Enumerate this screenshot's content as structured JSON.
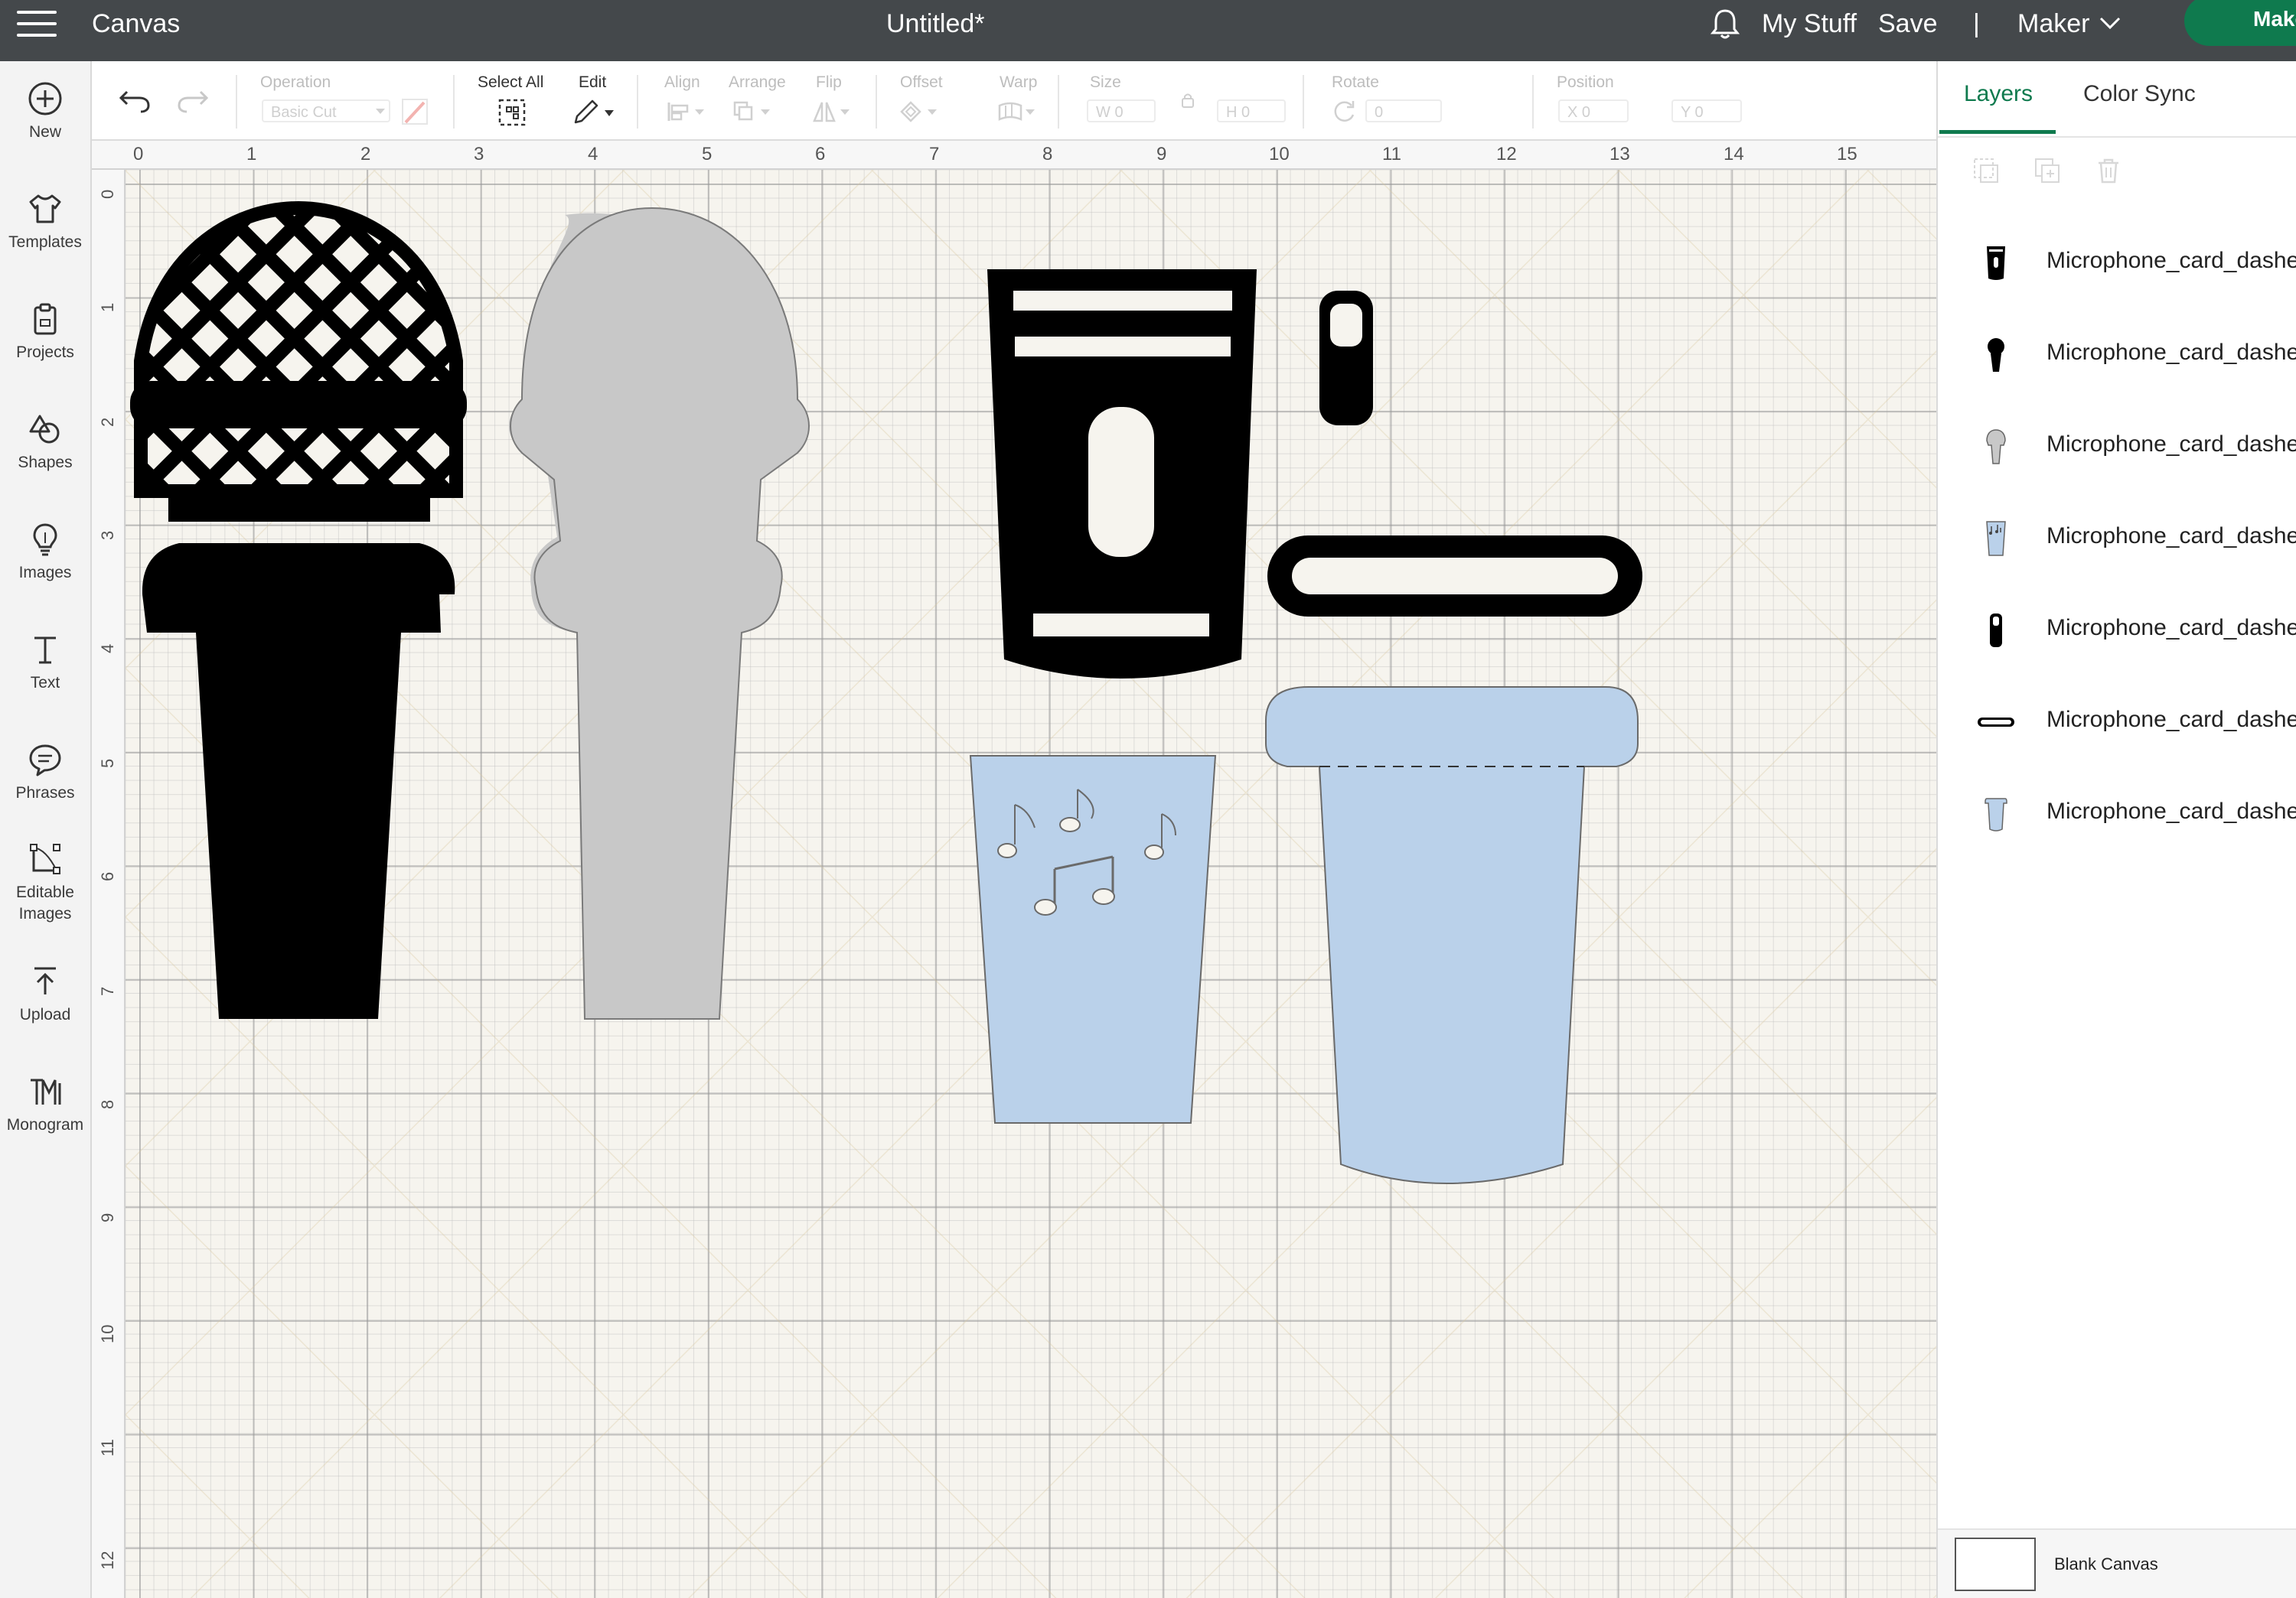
{
  "header": {
    "app_name": "Canvas",
    "doc_title": "Untitled*",
    "my_stuff": "My Stuff",
    "save": "Save",
    "separator": "|",
    "machine": "Maker",
    "make": "Make",
    "icons": [
      "menu-icon",
      "bell-icon",
      "chevron-down-icon"
    ]
  },
  "sidebar": {
    "items": [
      {
        "label": "New",
        "icon": "plus-circle-icon"
      },
      {
        "label": "Templates",
        "icon": "shirt-icon"
      },
      {
        "label": "Projects",
        "icon": "clipboard-icon"
      },
      {
        "label": "Shapes",
        "icon": "shapes-icon"
      },
      {
        "label": "Images",
        "icon": "lightbulb-icon"
      },
      {
        "label": "Text",
        "icon": "text-icon"
      },
      {
        "label": "Phrases",
        "icon": "speech-bubble-icon"
      },
      {
        "label": "Editable",
        "label2": "Images",
        "icon": "vector-edit-icon"
      },
      {
        "label": "Upload",
        "icon": "upload-icon"
      },
      {
        "label": "Monogram",
        "icon": "monogram-icon"
      }
    ]
  },
  "toolbar": {
    "operation_label": "Operation",
    "operation_value": "Basic Cut",
    "select_all": "Select All",
    "edit": "Edit",
    "align": "Align",
    "arrange": "Arrange",
    "flip": "Flip",
    "offset": "Offset",
    "warp": "Warp",
    "size": "Size",
    "size_w": "W",
    "size_h": "H",
    "rotate": "Rotate",
    "position": "Position",
    "pos_x": "X",
    "pos_y": "Y",
    "field_value": "0"
  },
  "rulers": {
    "top": [
      "0",
      "1",
      "2",
      "3",
      "4",
      "5",
      "6",
      "7",
      "8",
      "9",
      "10",
      "11",
      "12",
      "13",
      "14",
      "15"
    ],
    "left": [
      "0",
      "1",
      "2",
      "3",
      "4",
      "5",
      "6",
      "7",
      "8",
      "9",
      "10",
      "11",
      "12"
    ]
  },
  "panel": {
    "tabs": [
      "Layers",
      "Color Sync"
    ],
    "active_tab": "Layers",
    "layers": [
      {
        "name": "Microphone_card_dashe",
        "thumb": "black-cup-thumb"
      },
      {
        "name": "Microphone_card_dashe",
        "thumb": "black-mic-thumb"
      },
      {
        "name": "Microphone_card_dashe",
        "thumb": "gray-mic-thumb"
      },
      {
        "name": "Microphone_card_dashe",
        "thumb": "blue-notes-cup-thumb"
      },
      {
        "name": "Microphone_card_dashe",
        "thumb": "black-switch-thumb"
      },
      {
        "name": "Microphone_card_dashe",
        "thumb": "black-band-thumb"
      },
      {
        "name": "Microphone_card_dashe",
        "thumb": "blue-cup-thumb"
      }
    ],
    "blank_canvas": "Blank Canvas"
  },
  "colors": {
    "topbar": "#44484b",
    "accent": "#0f7a4e",
    "black_layer": "#000000",
    "gray_layer": "#c8c8c8",
    "blue_layer": "#bad1ea"
  }
}
